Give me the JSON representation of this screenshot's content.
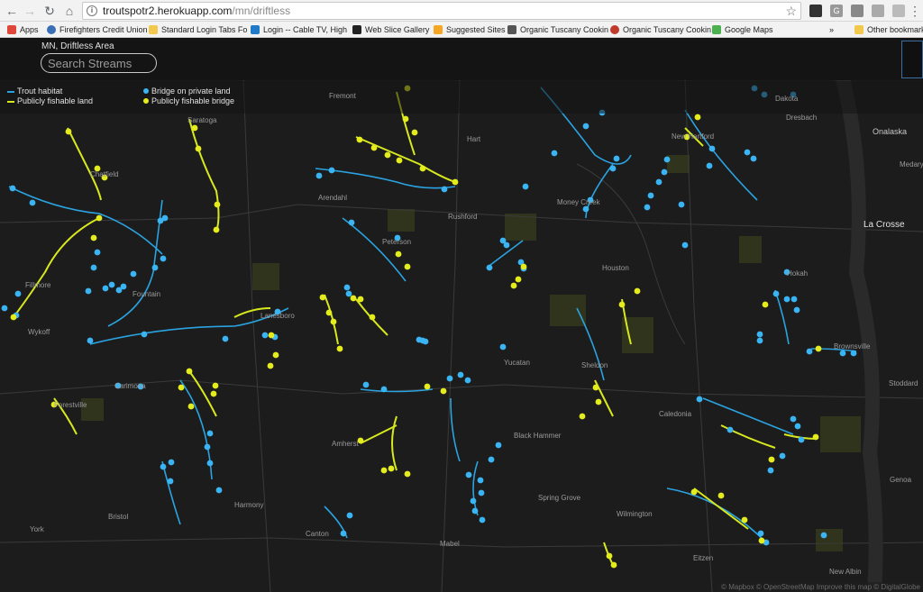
{
  "browser": {
    "url_host": "troutspotr2.herokuapp.com",
    "url_path": "/mn/driftless",
    "back_icon": "arrow-left-icon",
    "forward_icon": "arrow-right-icon",
    "reload_icon": "reload-icon",
    "home_icon": "home-icon",
    "star_icon": "star-icon"
  },
  "bookmarks": [
    {
      "label": "Apps",
      "color": "#e0463a"
    },
    {
      "label": "Firefighters Credit Union",
      "color": "#3b6fb6"
    },
    {
      "label": "Standard Login Tabs Fo",
      "color": "#f2c94c"
    },
    {
      "label": "Login -- Cable TV, High",
      "color": "#1f7ac7"
    },
    {
      "label": "Web Slice Gallery",
      "color": "#222222"
    },
    {
      "label": "Suggested Sites",
      "color": "#f6a623"
    },
    {
      "label": "Organic Tuscany Cookin",
      "color": "#555555"
    },
    {
      "label": "Organic Tuscany Cookin",
      "color": "#c0392b"
    },
    {
      "label": "Google Maps",
      "color": "#4caf50"
    },
    {
      "label": "»",
      "color": ""
    },
    {
      "label": "Other bookmarks",
      "color": "#f2c94c"
    }
  ],
  "app": {
    "region_label": "MN, Driftless Area",
    "search_placeholder": "Search Streams"
  },
  "legend": {
    "trout_habitat": "Trout habitat",
    "publicly_fishable_land": "Publicly fishable land",
    "bridge_private": "Bridge on private land",
    "bridge_public": "Publicly fishable bridge"
  },
  "colors": {
    "trout": "#2aa3e0",
    "public": "#d8e81e",
    "bridge_private": "#3ab4f2",
    "bridge_public": "#e4ec1c",
    "background": "#1c1c1c"
  },
  "places": [
    {
      "name": "Fremont",
      "size": "small"
    },
    {
      "name": "Hart",
      "size": "small"
    },
    {
      "name": "Dakota",
      "size": "small"
    },
    {
      "name": "Dresbach",
      "size": "small"
    },
    {
      "name": "Onalaska",
      "size": "mid"
    },
    {
      "name": "Medary",
      "size": "small"
    },
    {
      "name": "La Crosse",
      "size": "big"
    },
    {
      "name": "Saratoga",
      "size": "small"
    },
    {
      "name": "Chatfield",
      "size": "small"
    },
    {
      "name": "New Hartford",
      "size": "small"
    },
    {
      "name": "Arendahl",
      "size": "small"
    },
    {
      "name": "Rushford",
      "size": "small"
    },
    {
      "name": "Money Creek",
      "size": "small"
    },
    {
      "name": "Peterson",
      "size": "small"
    },
    {
      "name": "Houston",
      "size": "small"
    },
    {
      "name": "Hokah",
      "size": "small"
    },
    {
      "name": "Fillmore",
      "size": "small"
    },
    {
      "name": "Fountain",
      "size": "small"
    },
    {
      "name": "Lanesboro",
      "size": "small"
    },
    {
      "name": "Wykoff",
      "size": "small"
    },
    {
      "name": "Brownsville",
      "size": "small"
    },
    {
      "name": "Yucatan",
      "size": "small"
    },
    {
      "name": "Sheldon",
      "size": "small"
    },
    {
      "name": "Carimona",
      "size": "small"
    },
    {
      "name": "Stoddard",
      "size": "small"
    },
    {
      "name": "Caledonia",
      "size": "small"
    },
    {
      "name": "Forestville",
      "size": "small"
    },
    {
      "name": "Black Hammer",
      "size": "small"
    },
    {
      "name": "Amherst",
      "size": "small"
    },
    {
      "name": "Genoa",
      "size": "small"
    },
    {
      "name": "Spring Grove",
      "size": "small"
    },
    {
      "name": "Harmony",
      "size": "small"
    },
    {
      "name": "Bristol",
      "size": "small"
    },
    {
      "name": "Wilmington",
      "size": "small"
    },
    {
      "name": "York",
      "size": "small"
    },
    {
      "name": "Canton",
      "size": "small"
    },
    {
      "name": "Mabel",
      "size": "small"
    },
    {
      "name": "Eitzen",
      "size": "small"
    },
    {
      "name": "New Albin",
      "size": "small"
    }
  ],
  "attribution": "© Mapbox © OpenStreetMap  Improve this map © DigitalGlobe"
}
